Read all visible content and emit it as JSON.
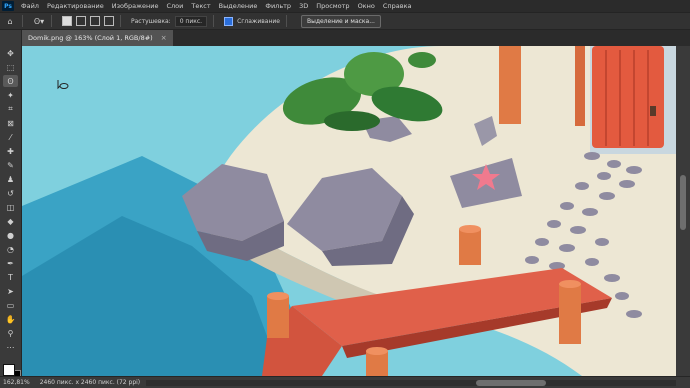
{
  "app": {
    "logo": "Ps"
  },
  "menu": [
    "Файл",
    "Редактирование",
    "Изображение",
    "Слои",
    "Текст",
    "Выделение",
    "Фильтр",
    "3D",
    "Просмотр",
    "Окно",
    "Справка"
  ],
  "options": {
    "feather_label": "Растушевка:",
    "feather_value": "0 пикс.",
    "antialias_label": "Сглаживание",
    "select_mask_button": "Выделение и маска..."
  },
  "document": {
    "tab_title": "Domik.png @ 163% (Слой 1, RGB/8#)",
    "close_glyph": "×"
  },
  "status": {
    "zoom": "162,81%",
    "doc_size": "2460 пикс. х 2460 пикс. (72 ppi)"
  },
  "tools": [
    {
      "name": "move-tool",
      "icon": "✥"
    },
    {
      "name": "marquee-tool",
      "icon": "⬚"
    },
    {
      "name": "lasso-tool",
      "icon": "ʘ"
    },
    {
      "name": "magic-wand-tool",
      "icon": "✦"
    },
    {
      "name": "crop-tool",
      "icon": "⌗"
    },
    {
      "name": "frame-tool",
      "icon": "⊠"
    },
    {
      "name": "eyedropper-tool",
      "icon": "⁄"
    },
    {
      "name": "healing-brush-tool",
      "icon": "✚"
    },
    {
      "name": "brush-tool",
      "icon": "✎"
    },
    {
      "name": "clone-stamp-tool",
      "icon": "♟"
    },
    {
      "name": "history-brush-tool",
      "icon": "↺"
    },
    {
      "name": "eraser-tool",
      "icon": "◫"
    },
    {
      "name": "paint-bucket-tool",
      "icon": "◆"
    },
    {
      "name": "blur-tool",
      "icon": "●"
    },
    {
      "name": "dodge-tool",
      "icon": "◔"
    },
    {
      "name": "pen-tool",
      "icon": "✒"
    },
    {
      "name": "type-tool",
      "icon": "T"
    },
    {
      "name": "path-selection-tool",
      "icon": "➤"
    },
    {
      "name": "rectangle-tool",
      "icon": "▭"
    },
    {
      "name": "hand-tool",
      "icon": "✋"
    },
    {
      "name": "zoom-tool",
      "icon": "⚲"
    },
    {
      "name": "more-tools",
      "icon": "⋯"
    }
  ],
  "colors": {
    "sea": "#7fcfdc",
    "water": "#2f9ec0",
    "sand": "#ece6d2",
    "pier": "#d85a45",
    "rock": "#8d8a9c",
    "leaf": "#3f8a3a",
    "accent": "#2a6edb"
  }
}
